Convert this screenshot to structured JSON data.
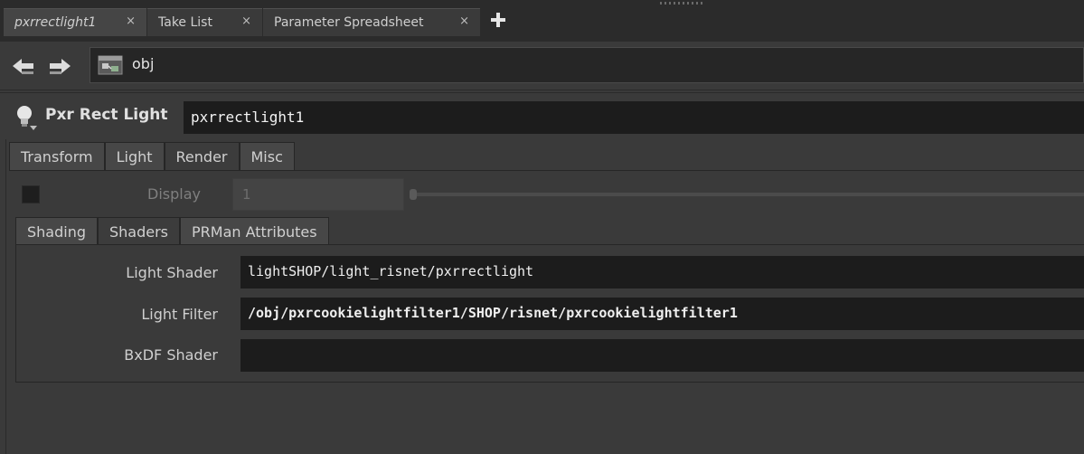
{
  "tabs": [
    {
      "label": "pxrrectlight1",
      "active": true
    },
    {
      "label": "Take List",
      "active": false
    },
    {
      "label": "Parameter Spreadsheet",
      "active": false
    }
  ],
  "tab_close_glyph": "×",
  "add_tab_icon": "plus-icon",
  "path": {
    "value": "obj",
    "icon": "object-network-icon"
  },
  "node": {
    "type": "Pxr Rect Light",
    "name": "pxrrectlight1",
    "icon": "light-bulb-icon"
  },
  "param_tabs": [
    "Transform",
    "Light",
    "Render",
    "Misc"
  ],
  "active_param_tab": "Render",
  "display": {
    "label": "Display",
    "value": "1",
    "enabled": false
  },
  "render_subtabs": [
    "Shading",
    "Shaders",
    "PRMan Attributes"
  ],
  "active_subtab": "Shaders",
  "shaders": {
    "light_shader": {
      "label": "Light Shader",
      "value": "lightSHOP/light_risnet/pxrrectlight"
    },
    "light_filter": {
      "label": "Light Filter",
      "value": "/obj/pxrcookielightfilter1/SHOP/risnet/pxrcookielightfilter1"
    },
    "bxdf_shader": {
      "label": "BxDF Shader",
      "value": ""
    }
  },
  "colors": {
    "background": "#3a3a3a",
    "field": "#1c1c1c",
    "text": "#d8d8d8"
  }
}
